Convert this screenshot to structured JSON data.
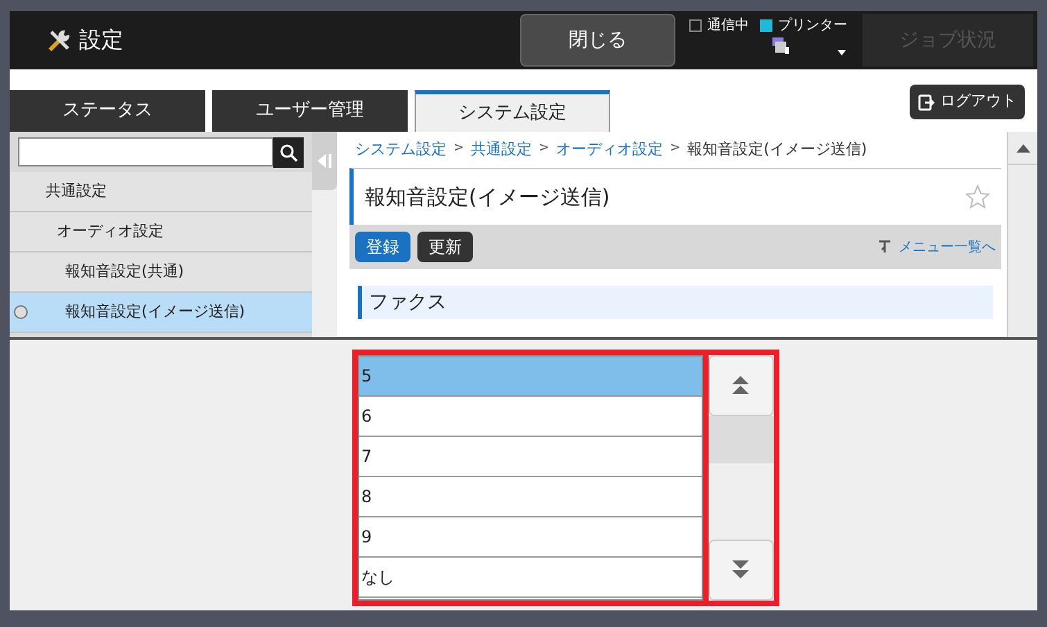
{
  "header": {
    "title": "設定",
    "close_button": "閉じる",
    "indicators": [
      {
        "label": "通信中",
        "on": false
      },
      {
        "label": "プリンター",
        "on": true
      }
    ],
    "job_button": {
      "label": "ジョブ状況",
      "disabled": true
    }
  },
  "tabs": [
    {
      "label": "ステータス",
      "selected": false
    },
    {
      "label": "ユーザー管理",
      "selected": false
    },
    {
      "label": "システム設定",
      "selected": true
    }
  ],
  "logout_button": "ログアウト",
  "sidebar": {
    "items": [
      {
        "label": "共通設定",
        "selected": false,
        "children": [
          {
            "label": "オーディオ設定",
            "selected": false,
            "children": [
              {
                "label": "報知音設定(共通)",
                "selected": false
              },
              {
                "label": "報知音設定(イメージ送信)",
                "selected": true
              }
            ]
          }
        ]
      }
    ]
  },
  "breadcrumb": {
    "separator": ">",
    "items": [
      {
        "label": "システム設定",
        "link": true
      },
      {
        "label": "共通設定",
        "link": true
      },
      {
        "label": "オーディオ設定",
        "link": true
      },
      {
        "label": "報知音設定(イメージ送信)",
        "link": false
      }
    ]
  },
  "page_title": "報知音設定(イメージ送信)",
  "actions": [
    {
      "label": "登録",
      "kind": "primary"
    },
    {
      "label": "更新",
      "kind": "secondary"
    }
  ],
  "menu_link": "メニュー一覧へ",
  "section": "ファクス",
  "picker": {
    "options": [
      {
        "label": "5",
        "selected": true
      },
      {
        "label": "6",
        "selected": false
      },
      {
        "label": "7",
        "selected": false
      },
      {
        "label": "8",
        "selected": false
      },
      {
        "label": "9",
        "selected": false
      },
      {
        "label": "なし",
        "selected": false
      }
    ]
  }
}
